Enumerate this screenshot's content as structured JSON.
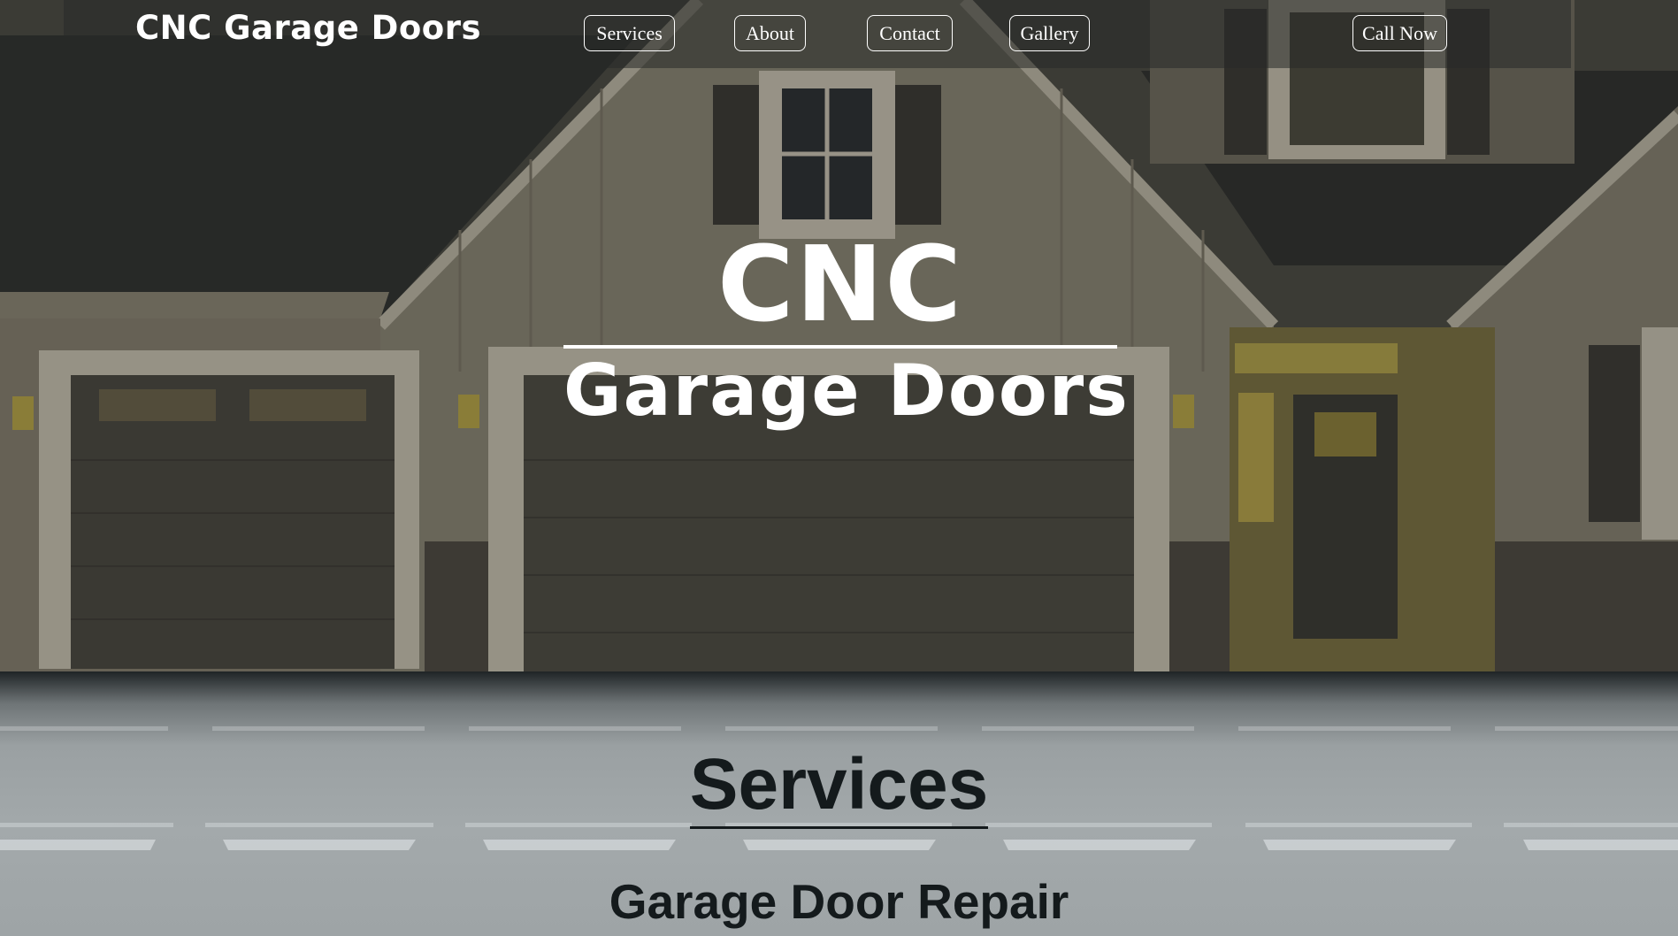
{
  "brand": "CNC Garage Doors",
  "nav": {
    "services": "Services",
    "about": "About",
    "contact": "Contact",
    "gallery": "Gallery",
    "call_now": "Call Now"
  },
  "hero": {
    "title_line1": "CNC",
    "title_line2": "Garage Doors"
  },
  "services": {
    "heading": "Services",
    "items": [
      "Garage Door Repair"
    ]
  },
  "colors": {
    "nav_text": "#ffffff",
    "heading_text": "#141a1c",
    "nav_bar": "#282a28"
  }
}
